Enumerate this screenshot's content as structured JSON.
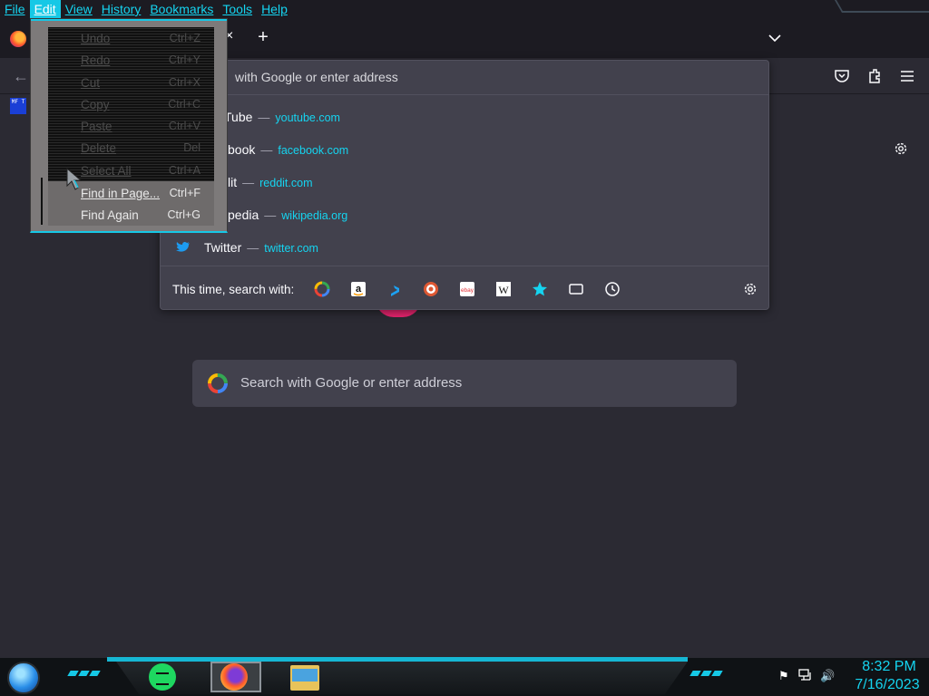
{
  "menubar": {
    "items": [
      "File",
      "Edit",
      "View",
      "History",
      "Bookmarks",
      "Tools",
      "Help"
    ],
    "active": "Edit"
  },
  "tabs": {
    "new_tab_symbol": "+",
    "close_symbol": "×"
  },
  "bookmarks_toolbar": {
    "icon_text": "MF T"
  },
  "url_panel": {
    "input_text": "with Google or enter address",
    "suggestions": [
      {
        "title": "Tube",
        "url": "youtube.com"
      },
      {
        "title": "book",
        "url": "facebook.com"
      },
      {
        "title": "lit",
        "url": "reddit.com"
      },
      {
        "title": "pedia",
        "url": "wikipedia.org"
      },
      {
        "title": "Twitter",
        "url": "twitter.com"
      }
    ],
    "dash": "—",
    "search_with_label": "This time, search with:",
    "engines": [
      "google-icon",
      "amazon-icon",
      "bing-icon",
      "duckduckgo-icon",
      "ebay-icon",
      "wikipedia-icon",
      "bookmarks-star-icon",
      "tabs-icon",
      "history-icon"
    ]
  },
  "newtab": {
    "search_placeholder": "Search with Google or enter address"
  },
  "edit_menu": {
    "items": [
      {
        "label": "Undo",
        "shortcut": "Ctrl+Z",
        "enabled": false
      },
      {
        "label": "Redo",
        "shortcut": "Ctrl+Y",
        "enabled": false
      },
      {
        "label": "Cut",
        "shortcut": "Ctrl+X",
        "enabled": false
      },
      {
        "label": "Copy",
        "shortcut": "Ctrl+C",
        "enabled": false
      },
      {
        "label": "Paste",
        "shortcut": "Ctrl+V",
        "enabled": false
      },
      {
        "label": "Delete",
        "shortcut": "Del",
        "enabled": false
      },
      {
        "label": "Select All",
        "shortcut": "Ctrl+A",
        "enabled": false
      },
      {
        "label": "Find in Page...",
        "shortcut": "Ctrl+F",
        "enabled": true
      },
      {
        "label": "Find Again",
        "shortcut": "Ctrl+G",
        "enabled": true
      }
    ]
  },
  "taskbar": {
    "time": "8:32 PM",
    "date": "7/16/2023",
    "apps": [
      "spotify-icon",
      "firefox-icon",
      "file-explorer-icon"
    ]
  },
  "colors": {
    "accent": "#16c8e6",
    "link": "#15d4f0",
    "background": "#2b2a33",
    "panel": "#42414d"
  }
}
